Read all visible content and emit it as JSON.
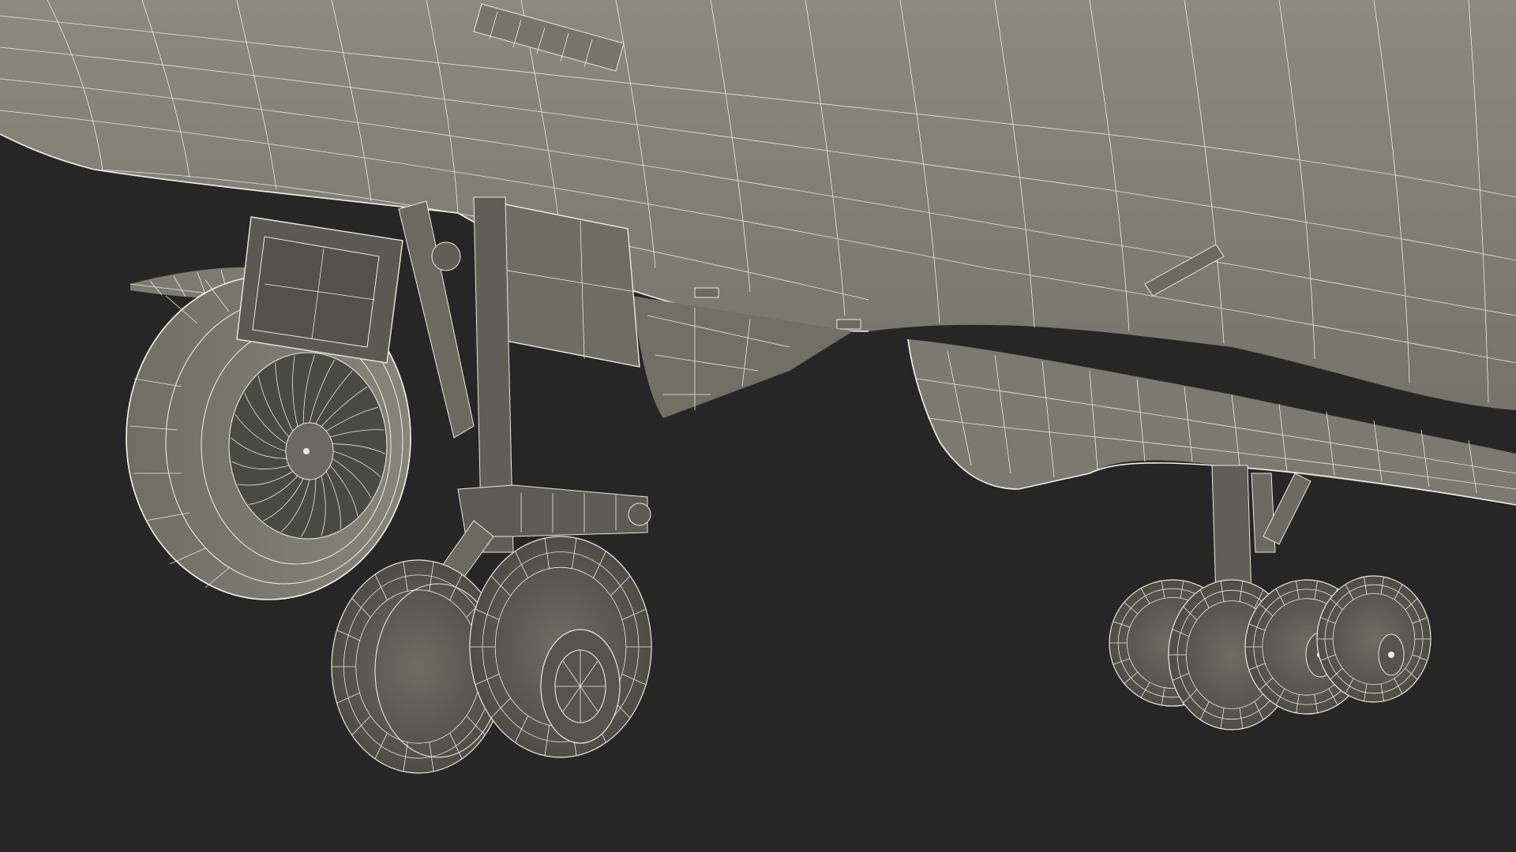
{
  "colors": {
    "background": "#262626",
    "surface": "#7f7f74",
    "surface_dark": "#5a5a51",
    "surface_shadow": "#45453f",
    "wireframe": "#e9e9df"
  },
  "components": [
    "fuselage",
    "wing",
    "engine-nacelle",
    "engine-fan",
    "nose-gear-door",
    "main-gear-door",
    "left-landing-gear",
    "right-landing-gear"
  ]
}
